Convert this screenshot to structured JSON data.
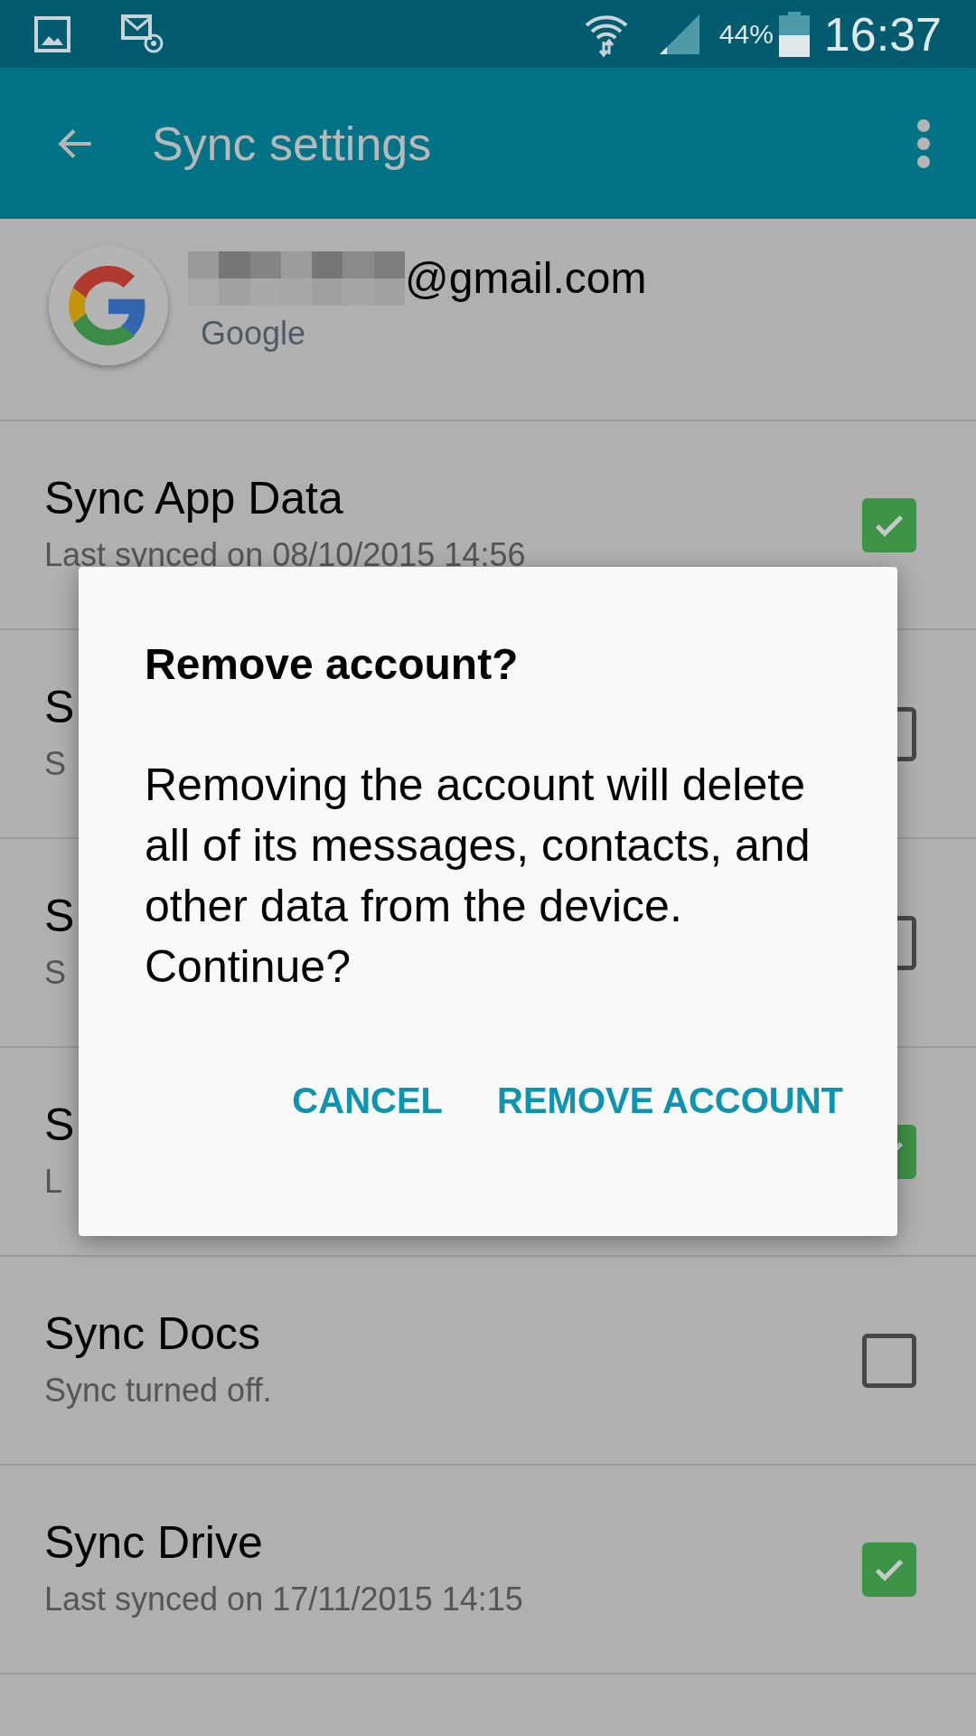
{
  "status_bar": {
    "battery": "44%",
    "time": "16:37"
  },
  "app_bar": {
    "title": "Sync settings"
  },
  "account": {
    "email": "@gmail.com",
    "provider": "Google"
  },
  "rows": [
    {
      "title": "Sync App Data",
      "subtitle": "Last synced on 08/10/2015 14:56",
      "checked": true
    },
    {
      "title": "S",
      "subtitle": "S",
      "checked": false
    },
    {
      "title": "S",
      "subtitle": "S",
      "checked": false
    },
    {
      "title": "S",
      "subtitle": "L",
      "checked": true
    },
    {
      "title": "Sync Docs",
      "subtitle": "Sync turned off.",
      "checked": false
    },
    {
      "title": "Sync Drive",
      "subtitle": "Last synced on 17/11/2015 14:15",
      "checked": true
    }
  ],
  "dialog": {
    "title": "Remove account?",
    "message": "Removing the account will delete all of its messages, contacts, and other data from the device. Continue?",
    "buttons": [
      "CANCEL",
      "REMOVE ACCOUNT"
    ]
  }
}
